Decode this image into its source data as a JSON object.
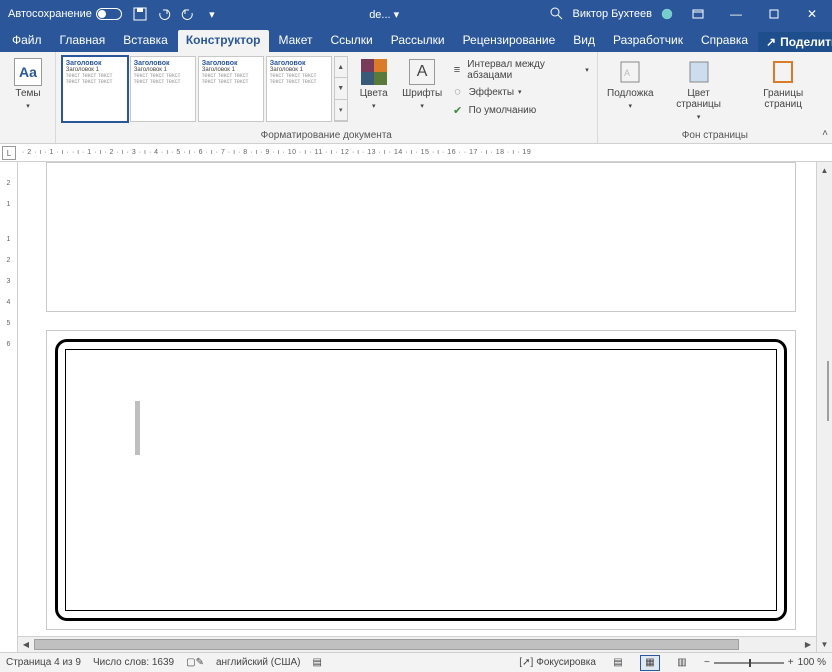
{
  "titlebar": {
    "autosave": "Автосохранение",
    "doc": "de...",
    "user": "Виктор Бухтеев"
  },
  "tabs": {
    "file": "Файл",
    "home": "Главная",
    "insert": "Вставка",
    "design": "Конструктор",
    "layout": "Макет",
    "references": "Ссылки",
    "mailings": "Рассылки",
    "review": "Рецензирование",
    "view": "Вид",
    "developer": "Разработчик",
    "help": "Справка",
    "share": "Поделиться"
  },
  "ribbon": {
    "themes": "Темы",
    "gallery_title": "Заголовок",
    "colors": "Цвета",
    "fonts": "Шрифты",
    "paragraph_spacing": "Интервал между абзацами",
    "effects": "Эффекты",
    "default": "По умолчанию",
    "group_formatting": "Форматирование документа",
    "watermark": "Подложка",
    "page_color": "Цвет страницы",
    "page_borders": "Границы страниц",
    "group_background": "Фон страницы"
  },
  "ruler": "· 2 · ı · 1 · ı ·   · ı · 1 · ı · 2 · ı · 3 · ı · 4 · ı · 5 · ı · 6 · ı · 7 · ı · 8 · ı · 9 · ı · 10 · ı · 11 · ı · 12 · ı · 13 · ı · 14 · ı · 15 · ı · 16 ·   · 17 · ı · 18 · ı · 19",
  "ruler_v": [
    "",
    "2",
    "1",
    "",
    "1",
    "2",
    "3",
    "4",
    "5",
    "6"
  ],
  "status": {
    "page": "Страница 4 из 9",
    "words": "Число слов: 1639",
    "lang": "английский (США)",
    "focus": "Фокусировка",
    "zoom": "100 %"
  }
}
